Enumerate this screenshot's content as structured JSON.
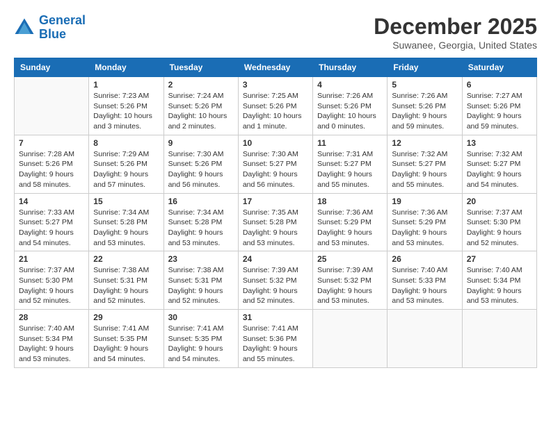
{
  "logo": {
    "line1": "General",
    "line2": "Blue"
  },
  "header": {
    "month": "December 2025",
    "location": "Suwanee, Georgia, United States"
  },
  "weekdays": [
    "Sunday",
    "Monday",
    "Tuesday",
    "Wednesday",
    "Thursday",
    "Friday",
    "Saturday"
  ],
  "weeks": [
    [
      {
        "day": "",
        "sunrise": "",
        "sunset": "",
        "daylight": ""
      },
      {
        "day": "1",
        "sunrise": "Sunrise: 7:23 AM",
        "sunset": "Sunset: 5:26 PM",
        "daylight": "Daylight: 10 hours and 3 minutes."
      },
      {
        "day": "2",
        "sunrise": "Sunrise: 7:24 AM",
        "sunset": "Sunset: 5:26 PM",
        "daylight": "Daylight: 10 hours and 2 minutes."
      },
      {
        "day": "3",
        "sunrise": "Sunrise: 7:25 AM",
        "sunset": "Sunset: 5:26 PM",
        "daylight": "Daylight: 10 hours and 1 minute."
      },
      {
        "day": "4",
        "sunrise": "Sunrise: 7:26 AM",
        "sunset": "Sunset: 5:26 PM",
        "daylight": "Daylight: 10 hours and 0 minutes."
      },
      {
        "day": "5",
        "sunrise": "Sunrise: 7:26 AM",
        "sunset": "Sunset: 5:26 PM",
        "daylight": "Daylight: 9 hours and 59 minutes."
      },
      {
        "day": "6",
        "sunrise": "Sunrise: 7:27 AM",
        "sunset": "Sunset: 5:26 PM",
        "daylight": "Daylight: 9 hours and 59 minutes."
      }
    ],
    [
      {
        "day": "7",
        "sunrise": "Sunrise: 7:28 AM",
        "sunset": "Sunset: 5:26 PM",
        "daylight": "Daylight: 9 hours and 58 minutes."
      },
      {
        "day": "8",
        "sunrise": "Sunrise: 7:29 AM",
        "sunset": "Sunset: 5:26 PM",
        "daylight": "Daylight: 9 hours and 57 minutes."
      },
      {
        "day": "9",
        "sunrise": "Sunrise: 7:30 AM",
        "sunset": "Sunset: 5:26 PM",
        "daylight": "Daylight: 9 hours and 56 minutes."
      },
      {
        "day": "10",
        "sunrise": "Sunrise: 7:30 AM",
        "sunset": "Sunset: 5:27 PM",
        "daylight": "Daylight: 9 hours and 56 minutes."
      },
      {
        "day": "11",
        "sunrise": "Sunrise: 7:31 AM",
        "sunset": "Sunset: 5:27 PM",
        "daylight": "Daylight: 9 hours and 55 minutes."
      },
      {
        "day": "12",
        "sunrise": "Sunrise: 7:32 AM",
        "sunset": "Sunset: 5:27 PM",
        "daylight": "Daylight: 9 hours and 55 minutes."
      },
      {
        "day": "13",
        "sunrise": "Sunrise: 7:32 AM",
        "sunset": "Sunset: 5:27 PM",
        "daylight": "Daylight: 9 hours and 54 minutes."
      }
    ],
    [
      {
        "day": "14",
        "sunrise": "Sunrise: 7:33 AM",
        "sunset": "Sunset: 5:27 PM",
        "daylight": "Daylight: 9 hours and 54 minutes."
      },
      {
        "day": "15",
        "sunrise": "Sunrise: 7:34 AM",
        "sunset": "Sunset: 5:28 PM",
        "daylight": "Daylight: 9 hours and 53 minutes."
      },
      {
        "day": "16",
        "sunrise": "Sunrise: 7:34 AM",
        "sunset": "Sunset: 5:28 PM",
        "daylight": "Daylight: 9 hours and 53 minutes."
      },
      {
        "day": "17",
        "sunrise": "Sunrise: 7:35 AM",
        "sunset": "Sunset: 5:28 PM",
        "daylight": "Daylight: 9 hours and 53 minutes."
      },
      {
        "day": "18",
        "sunrise": "Sunrise: 7:36 AM",
        "sunset": "Sunset: 5:29 PM",
        "daylight": "Daylight: 9 hours and 53 minutes."
      },
      {
        "day": "19",
        "sunrise": "Sunrise: 7:36 AM",
        "sunset": "Sunset: 5:29 PM",
        "daylight": "Daylight: 9 hours and 53 minutes."
      },
      {
        "day": "20",
        "sunrise": "Sunrise: 7:37 AM",
        "sunset": "Sunset: 5:30 PM",
        "daylight": "Daylight: 9 hours and 52 minutes."
      }
    ],
    [
      {
        "day": "21",
        "sunrise": "Sunrise: 7:37 AM",
        "sunset": "Sunset: 5:30 PM",
        "daylight": "Daylight: 9 hours and 52 minutes."
      },
      {
        "day": "22",
        "sunrise": "Sunrise: 7:38 AM",
        "sunset": "Sunset: 5:31 PM",
        "daylight": "Daylight: 9 hours and 52 minutes."
      },
      {
        "day": "23",
        "sunrise": "Sunrise: 7:38 AM",
        "sunset": "Sunset: 5:31 PM",
        "daylight": "Daylight: 9 hours and 52 minutes."
      },
      {
        "day": "24",
        "sunrise": "Sunrise: 7:39 AM",
        "sunset": "Sunset: 5:32 PM",
        "daylight": "Daylight: 9 hours and 52 minutes."
      },
      {
        "day": "25",
        "sunrise": "Sunrise: 7:39 AM",
        "sunset": "Sunset: 5:32 PM",
        "daylight": "Daylight: 9 hours and 53 minutes."
      },
      {
        "day": "26",
        "sunrise": "Sunrise: 7:40 AM",
        "sunset": "Sunset: 5:33 PM",
        "daylight": "Daylight: 9 hours and 53 minutes."
      },
      {
        "day": "27",
        "sunrise": "Sunrise: 7:40 AM",
        "sunset": "Sunset: 5:34 PM",
        "daylight": "Daylight: 9 hours and 53 minutes."
      }
    ],
    [
      {
        "day": "28",
        "sunrise": "Sunrise: 7:40 AM",
        "sunset": "Sunset: 5:34 PM",
        "daylight": "Daylight: 9 hours and 53 minutes."
      },
      {
        "day": "29",
        "sunrise": "Sunrise: 7:41 AM",
        "sunset": "Sunset: 5:35 PM",
        "daylight": "Daylight: 9 hours and 54 minutes."
      },
      {
        "day": "30",
        "sunrise": "Sunrise: 7:41 AM",
        "sunset": "Sunset: 5:35 PM",
        "daylight": "Daylight: 9 hours and 54 minutes."
      },
      {
        "day": "31",
        "sunrise": "Sunrise: 7:41 AM",
        "sunset": "Sunset: 5:36 PM",
        "daylight": "Daylight: 9 hours and 55 minutes."
      },
      {
        "day": "",
        "sunrise": "",
        "sunset": "",
        "daylight": ""
      },
      {
        "day": "",
        "sunrise": "",
        "sunset": "",
        "daylight": ""
      },
      {
        "day": "",
        "sunrise": "",
        "sunset": "",
        "daylight": ""
      }
    ]
  ]
}
